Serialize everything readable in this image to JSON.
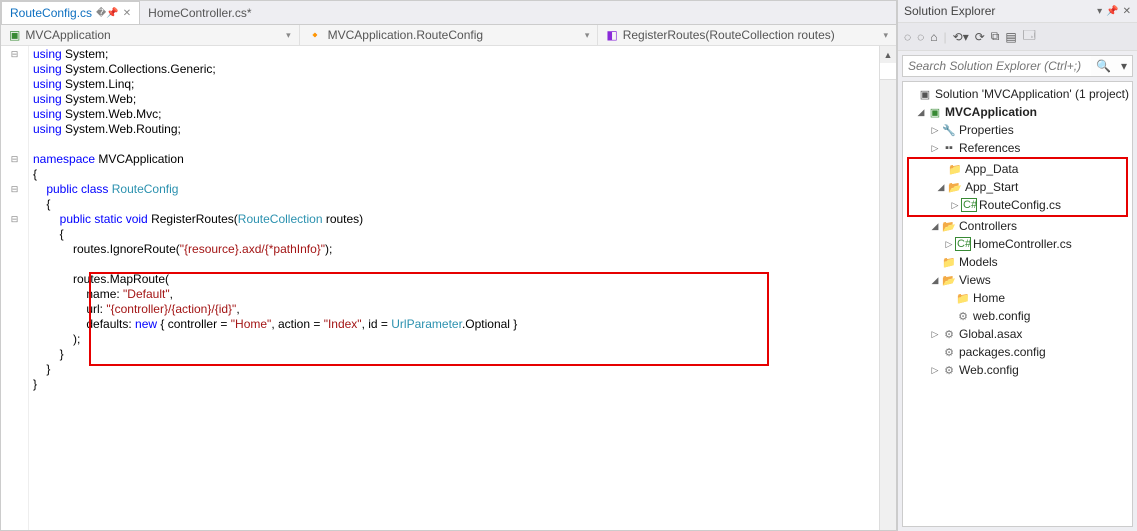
{
  "tabs": [
    {
      "label": "RouteConfig.cs",
      "active": true
    },
    {
      "label": "HomeController.cs*",
      "active": false
    }
  ],
  "crumbs": {
    "c1": "MVCApplication",
    "c2": "MVCApplication.RouteConfig",
    "c3": "RegisterRoutes(RouteCollection routes)"
  },
  "code": {
    "l1a": "using",
    "l1b": " System;",
    "l2a": "using",
    "l2b": " System.Collections.Generic;",
    "l3a": "using",
    "l3b": " System.Linq;",
    "l4a": "using",
    "l4b": " System.Web;",
    "l5a": "using",
    "l5b": " System.Web.Mvc;",
    "l6a": "using",
    "l6b": " System.Web.Routing;",
    "l8a": "namespace",
    "l8b": " MVCApplication",
    "l9": "{",
    "l10a": "    public",
    "l10b": " class",
    "l10c": " RouteConfig",
    "l11": "    {",
    "l12a": "        public",
    "l12b": " static",
    "l12c": " void",
    "l12d": " RegisterRoutes(",
    "l12e": "RouteCollection",
    "l12f": " routes)",
    "l13": "        {",
    "l14a": "            routes.IgnoreRoute(",
    "l14b": "\"{resource}.axd/{*pathInfo}\"",
    "l14c": ");",
    "l16": "            routes.MapRoute(",
    "l17a": "                name: ",
    "l17b": "\"Default\"",
    "l17c": ",",
    "l18a": "                url: ",
    "l18b": "\"{controller}/{action}/{id}\"",
    "l18c": ",",
    "l19a": "                defaults: ",
    "l19b": "new",
    "l19c": " { controller = ",
    "l19d": "\"Home\"",
    "l19e": ", action = ",
    "l19f": "\"Index\"",
    "l19g": ", id = ",
    "l19h": "UrlParameter",
    "l19i": ".Optional }",
    "l20": "            );",
    "l21": "        }",
    "l22": "    }",
    "l23": "}"
  },
  "solExplorer": {
    "title": "Solution Explorer",
    "searchPlaceholder": "Search Solution Explorer (Ctrl+;)",
    "nodes": {
      "solution": "Solution 'MVCApplication' (1 project)",
      "project": "MVCApplication",
      "properties": "Properties",
      "references": "References",
      "appdata": "App_Data",
      "appstart": "App_Start",
      "routeconfig": "RouteConfig.cs",
      "controllers": "Controllers",
      "homectrl": "HomeController.cs",
      "models": "Models",
      "views": "Views",
      "home": "Home",
      "webconfig1": "web.config",
      "globalasax": "Global.asax",
      "packages": "packages.config",
      "webconfig2": "Web.config"
    }
  }
}
